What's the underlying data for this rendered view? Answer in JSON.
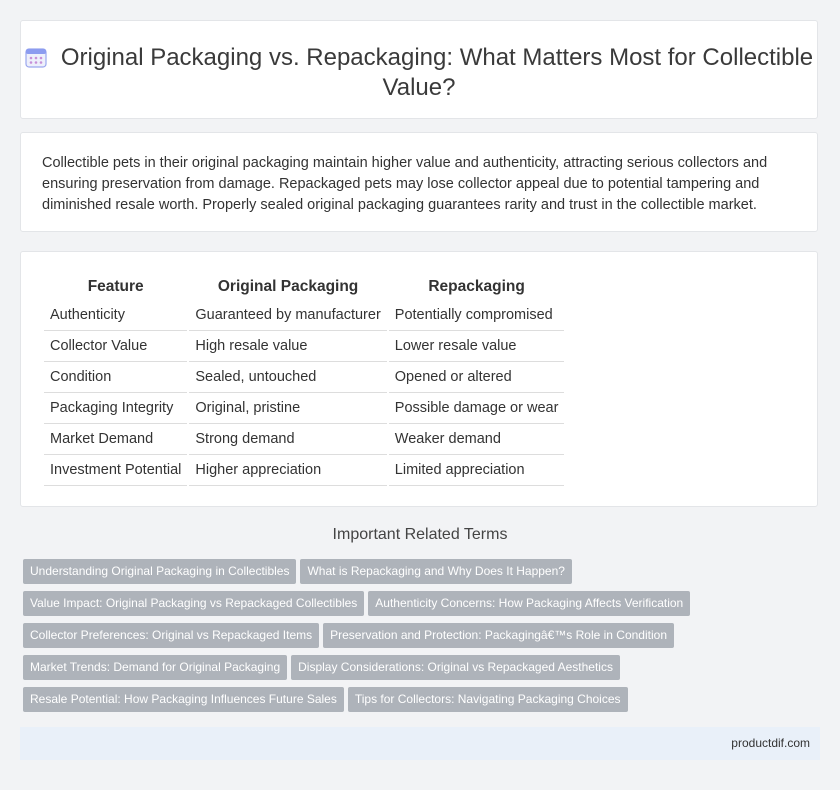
{
  "header": {
    "title": "Original Packaging vs. Repackaging: What Matters Most for Collectible Value?",
    "icon": "calendar-icon"
  },
  "summary": {
    "text": "Collectible pets in their original packaging maintain higher value and authenticity, attracting serious collectors and ensuring preservation from damage. Repackaged pets may lose collector appeal due to potential tampering and diminished resale worth. Properly sealed original packaging guarantees rarity and trust in the collectible market."
  },
  "table": {
    "headers": [
      "Feature",
      "Original Packaging",
      "Repackaging"
    ],
    "rows": [
      [
        "Authenticity",
        "Guaranteed by manufacturer",
        "Potentially compromised"
      ],
      [
        "Collector Value",
        "High resale value",
        "Lower resale value"
      ],
      [
        "Condition",
        "Sealed, untouched",
        "Opened or altered"
      ],
      [
        "Packaging Integrity",
        "Original, pristine",
        "Possible damage or wear"
      ],
      [
        "Market Demand",
        "Strong demand",
        "Weaker demand"
      ],
      [
        "Investment Potential",
        "Higher appreciation",
        "Limited appreciation"
      ]
    ]
  },
  "related": {
    "title": "Important Related Terms",
    "tags": [
      [
        "Understanding Original Packaging in Collectibles",
        "What is Repackaging and Why Does It Happen?"
      ],
      [
        "Value Impact: Original Packaging vs Repackaged Collectibles",
        "Authenticity Concerns: How Packaging Affects Verification"
      ],
      [
        "Collector Preferences: Original vs Repackaged Items",
        "Preservation and Protection: Packagingâ€™s Role in Condition"
      ],
      [
        "Market Trends: Demand for Original Packaging",
        "Display Considerations: Original vs Repackaged Aesthetics"
      ],
      [
        "Resale Potential: How Packaging Influences Future Sales",
        "Tips for Collectors: Navigating Packaging Choices"
      ]
    ]
  },
  "footer": {
    "text": "productdif.com"
  },
  "colors": {
    "tag_bg": "#aeb3ba",
    "footer_bg": "#e9f0f9",
    "icon_accent": "#7b8cf2"
  }
}
